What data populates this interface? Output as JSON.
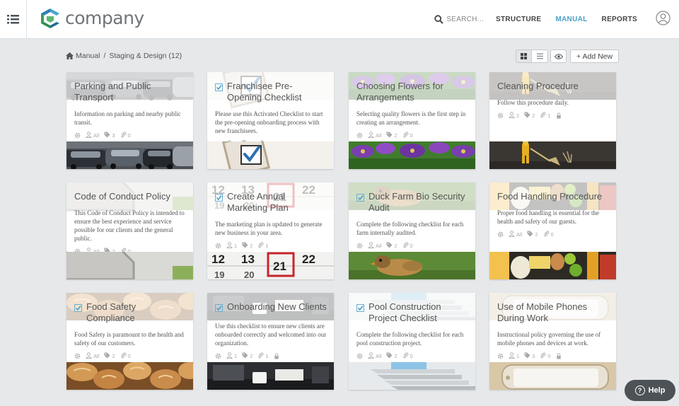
{
  "header": {
    "logo_text": "company",
    "search_label": "SEARCH...",
    "nav": [
      "STRUCTURE",
      "MANUAL",
      "REPORTS"
    ],
    "active_nav": "MANUAL",
    "accent_color": "#4a9fc7"
  },
  "breadcrumb": {
    "root": "Manual",
    "separator": "/",
    "current": "Staging & Design (12)"
  },
  "toolbar": {
    "add_label": "+ Add New",
    "view_mode": "grid"
  },
  "cards": [
    {
      "title": "Parking and Public Transport",
      "checklist": false,
      "desc": "Information on parking and nearby public transit.",
      "meta": {
        "cog": "",
        "users": "All",
        "tags": "3",
        "attach": "0"
      },
      "photo": "parked-cars"
    },
    {
      "title": "Franchisee Pre-Opening Checklist",
      "checklist": true,
      "desc": "Please use this Activated Checklist to start the pre-opening onboarding process with new franchisees.",
      "meta": {
        "cog": "",
        "users": "2",
        "tags": "3",
        "attach": "0"
      },
      "photo": "checkbox-tick"
    },
    {
      "title": "Choosing Flowers for Arrangements",
      "checklist": false,
      "desc": "Selecting quality flowers is the first step in creating an arrangement.",
      "meta": {
        "cog": "",
        "users": "All",
        "tags": "2",
        "attach": "0"
      },
      "photo": "purple-flowers"
    },
    {
      "title": "Cleaning Procedure",
      "checklist": false,
      "desc": "Follow this procedure daily.",
      "meta": {
        "cog": "",
        "users": "2",
        "tags": "2",
        "attach": "1",
        "lock": true
      },
      "photo": "broom-figurine"
    },
    {
      "title": "Code of Conduct Policy",
      "checklist": false,
      "desc": "This Code of Conduct Policy is intended to ensure the best experience and service possible for our clients and the general public.",
      "meta": {
        "cog": "",
        "users": "All",
        "tags": "2",
        "attach": "0"
      },
      "photo": "stop-sign"
    },
    {
      "title": "Create Annual Marketing Plan",
      "checklist": true,
      "desc": "The marketing plan is updated to generate new business in your area.",
      "meta": {
        "cog": "",
        "users": "1",
        "tags": "2",
        "attach": "1"
      },
      "photo": "calendar",
      "calendar_numbers": [
        "12",
        "13",
        "21",
        "22"
      ]
    },
    {
      "title": "Duck Farm Bio Security Audit",
      "checklist": true,
      "desc": "Complete the following checklist for each farm internally audited.",
      "meta": {
        "cog": "",
        "users": "All",
        "tags": "2",
        "attach": "0"
      },
      "photo": "duckling"
    },
    {
      "title": "Food Handling Procedure",
      "checklist": false,
      "desc": "Proper food handling is essential for the health and safety of our guests.",
      "meta": {
        "cog": "",
        "users": "All",
        "tags": "2",
        "attach": "0"
      },
      "photo": "food-items"
    },
    {
      "title": "Food Safety Compliance",
      "checklist": true,
      "desc": "Food Safety is paramount to the health and safety of our customers.",
      "meta": {
        "cog": "",
        "users": "All",
        "tags": "2",
        "attach": "0"
      },
      "photo": "bread-rolls"
    },
    {
      "title": "Onboarding New Clients",
      "checklist": true,
      "desc": "Use this checklist to ensure new clients are onboarded correctly and welcomed into our organization.",
      "meta": {
        "cog": "",
        "users": "1",
        "tags": "2",
        "attach": "1",
        "lock": true
      },
      "photo": "office-desk"
    },
    {
      "title": "Pool Construction Project Checklist",
      "checklist": true,
      "desc": "Complete the following checklist for each pool construction project.",
      "meta": {
        "cog": "",
        "users": "All",
        "tags": "2",
        "attach": "0"
      },
      "photo": "pool-steps"
    },
    {
      "title": "Use of Mobile Phones During Work",
      "checklist": false,
      "desc": "Instructional policy governing the use of mobile phones and devices at work.",
      "meta": {
        "cog": "",
        "users": "1",
        "tags": "3",
        "attach": "0",
        "lock": true
      },
      "photo": "smartphone"
    }
  ],
  "help": {
    "label": "Help"
  }
}
